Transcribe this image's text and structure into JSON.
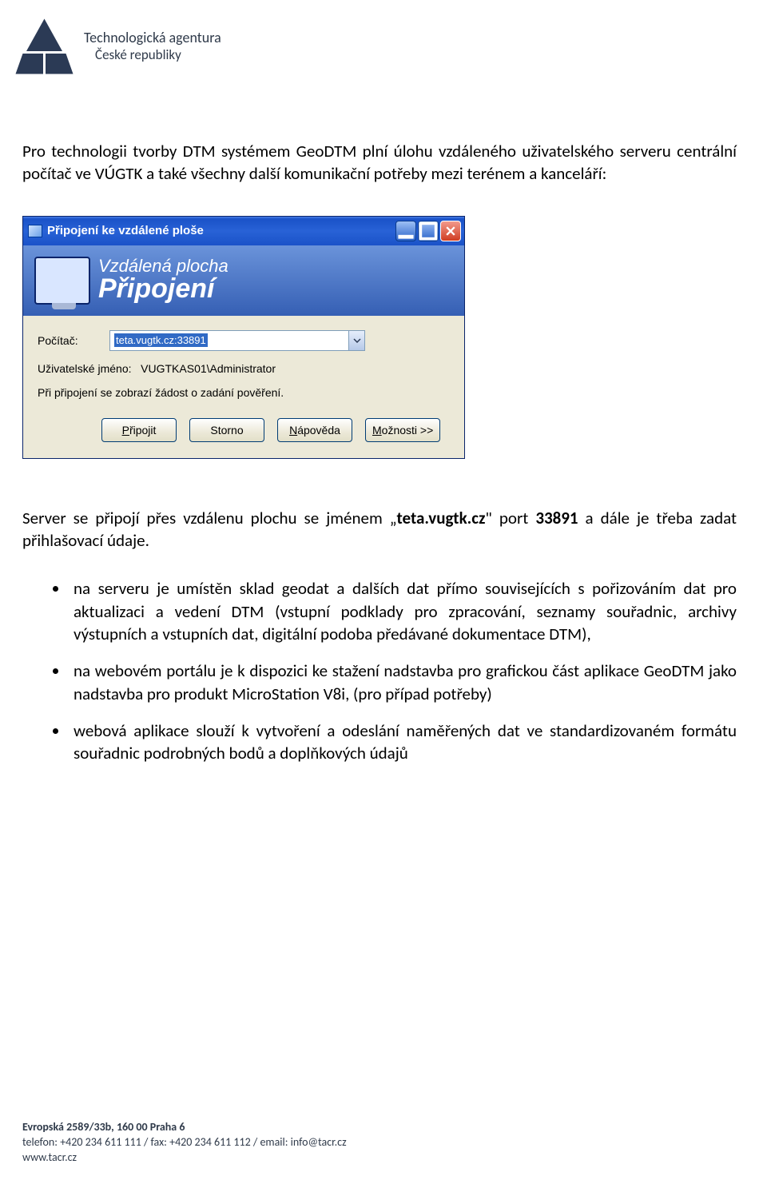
{
  "header": {
    "logo_line1": "Technologická agentura",
    "logo_line2": "České republiky"
  },
  "para1": "Pro technologii tvorby DTM systémem GeoDTM plní úlohu vzdáleného uživatelského serveru centrální počítač ve VÚGTK a také všechny další komunikační potřeby mezi terénem a kanceláří:",
  "rdp": {
    "title": "Připojení ke vzdálené ploše",
    "banner_l1": "Vzdálená plocha",
    "banner_l2": "Připojení",
    "label_computer": "Počítač:",
    "input_value": "teta.vugtk.cz:33891",
    "user_prefix": "Uživatelské jméno:",
    "user_value": "VUGTKAS01\\Administrator",
    "note": "Při připojení se zobrazí žádost o zadání pověření.",
    "btn_connect": "Připojit",
    "btn_cancel": "Storno",
    "btn_help": "Nápověda",
    "btn_options": "Možnosti >>"
  },
  "para2_pre": "Server se připojí přes vzdálenu plochu se jménem „",
  "para2_bold1": "teta.vugtk.cz",
  "para2_mid": "\" port ",
  "para2_bold2": "33891",
  "para2_post": " a dále je třeba zadat přihlašovací údaje.",
  "bullets": [
    "na serveru je umístěn sklad geodat a dalších dat přímo souvisejících s pořizováním dat pro aktualizaci a vedení DTM  (vstupní podklady pro zpracování, seznamy souřadnic, archivy výstupních a vstupních dat, digitální podoba předávané dokumentace DTM),",
    "na webovém portálu je k dispozici ke stažení nadstavba pro grafickou část aplikace GeoDTM jako nadstavba pro produkt MicroStation V8i, (pro případ potřeby)",
    "webová aplikace slouží k vytvoření a odeslání naměřených dat ve standardizovaném formátu souřadnic podrobných bodů a doplňkových údajů"
  ],
  "footer": {
    "addr": "Evropská 2589/33b, 160 00 Praha 6",
    "contact": "telefon: +420 234 611 111 / fax: +420 234 611 112 / email: info@tacr.cz",
    "web": "www.tacr.cz"
  }
}
